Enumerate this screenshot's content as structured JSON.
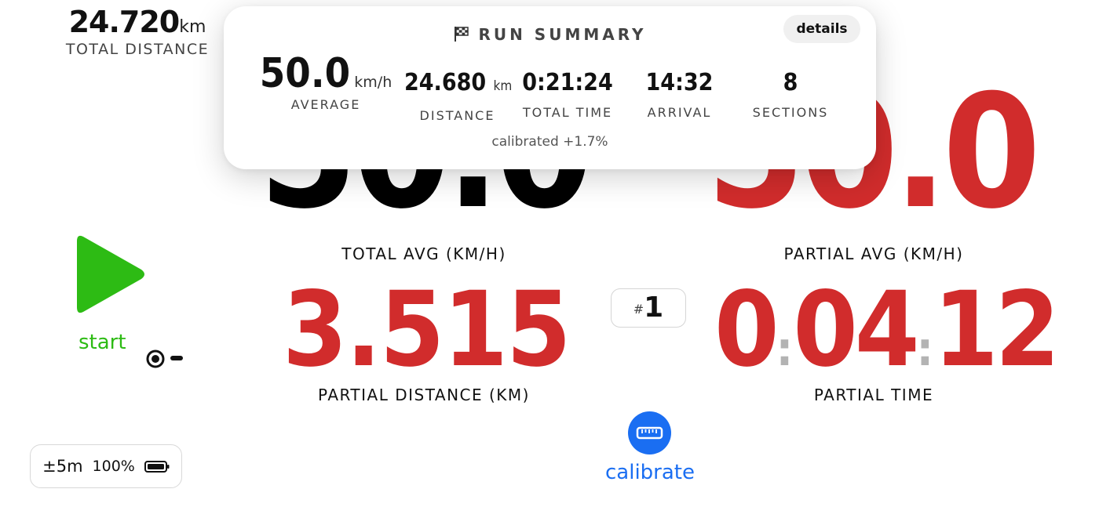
{
  "total_distance": {
    "value": "24.720",
    "unit": "km",
    "label": "TOTAL DISTANCE"
  },
  "total_avg": {
    "value": "50.0",
    "label": "TOTAL AVG (KM/H)"
  },
  "partial_avg": {
    "value": "50.0",
    "label": "PARTIAL AVG (KM/H)"
  },
  "partial_distance": {
    "value": "3.515",
    "label": "PARTIAL DISTANCE (KM)"
  },
  "partial_time": {
    "h": "0",
    "m": "04",
    "s": "12",
    "label": "PARTIAL TIME"
  },
  "section_counter": {
    "hash": "#",
    "number": "1"
  },
  "start": {
    "label": "start"
  },
  "status": {
    "accuracy": "±5m",
    "battery": "100%"
  },
  "calibrate": {
    "label": "calibrate"
  },
  "summary": {
    "title": "RUN SUMMARY",
    "details_label": "details",
    "average": {
      "value": "50.0",
      "unit": "km/h",
      "label": "AVERAGE"
    },
    "distance": {
      "value": "24.680",
      "unit": "km",
      "label": "DISTANCE"
    },
    "total_time": {
      "value": "0:21:24",
      "label": "TOTAL TIME"
    },
    "arrival": {
      "value": "14:32",
      "label": "ARRIVAL"
    },
    "sections": {
      "value": "8",
      "label": "SECTIONS"
    },
    "note": "calibrated +1.7%"
  },
  "colors": {
    "red": "#d12c2c",
    "green": "#2dbb14",
    "blue": "#1a6ef2"
  },
  "icons": [
    "play-icon",
    "gps-icon",
    "battery-icon",
    "ruler-icon",
    "checkered-flag-icon"
  ]
}
